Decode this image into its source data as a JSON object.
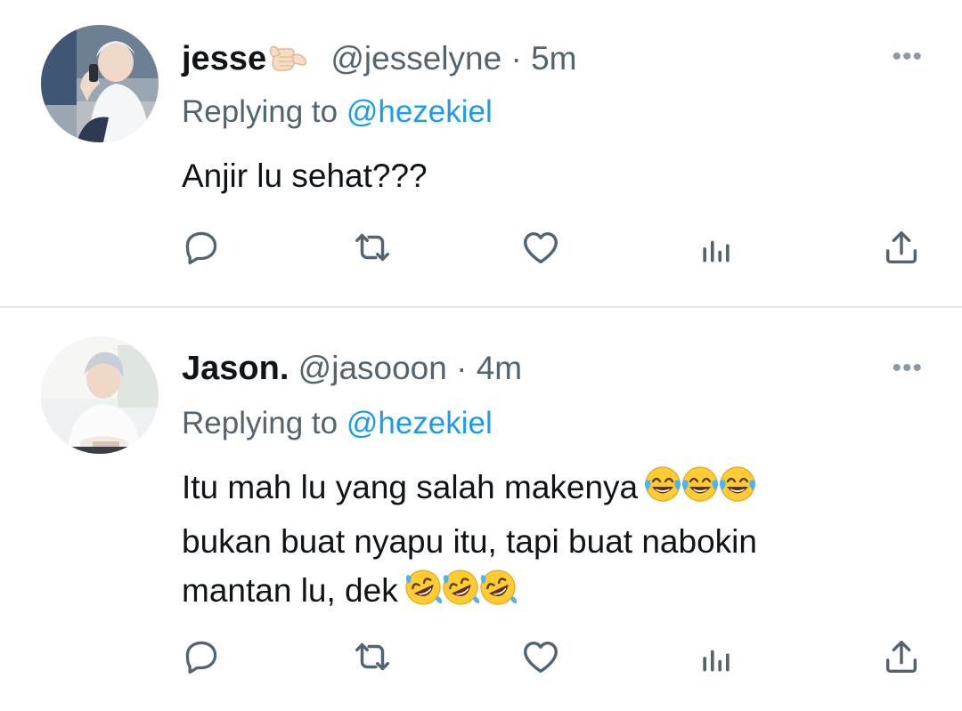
{
  "colors": {
    "text": "#0f1419",
    "secondary": "#536471",
    "mention": "#1d9bf0",
    "icon": "#536471",
    "divider": "#e1e8ed"
  },
  "tweets": [
    {
      "display_name": "jesse",
      "name_emoji": "call-me-hand-emoji",
      "handle": "@jesselyne",
      "separator": "·",
      "time": "5m",
      "more": "•••",
      "replying_prefix": "Replying to",
      "replying_to": "@hezekiel",
      "lines": [
        "Anjir lu sehat???"
      ]
    },
    {
      "display_name": "Jason.",
      "handle": "@jasooon",
      "separator": "·",
      "time": "4m",
      "more": "•••",
      "replying_prefix": "Replying to",
      "replying_to": "@hezekiel",
      "lines": [
        "Itu mah lu yang salah makenya",
        "bukan buat nyapu itu, tapi buat nabokin",
        "mantan lu, dek"
      ],
      "line_emojis": [
        "face-with-tears-of-joy-emoji",
        "rolling-on-floor-laughing-emoji"
      ]
    }
  ],
  "actions": [
    "reply-icon",
    "retweet-icon",
    "like-icon",
    "analytics-icon",
    "share-icon"
  ]
}
